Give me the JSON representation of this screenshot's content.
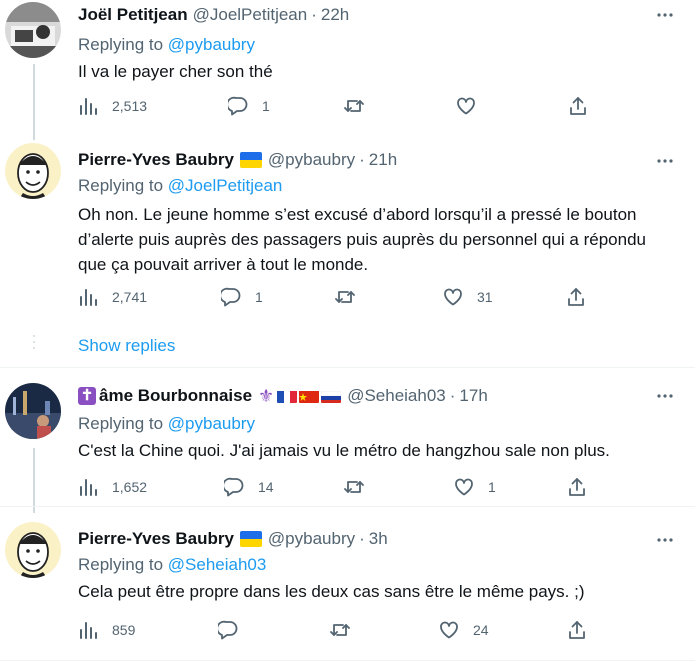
{
  "tweets": [
    {
      "name": "Joël Petitjean",
      "handle": "@JoelPetitjean",
      "time": "22h",
      "replying_prefix": "Replying to ",
      "replying_to": "@pybaubry",
      "text": "Il va le payer cher son thé",
      "stats": {
        "views": "2,513",
        "replies": "1",
        "retweets": "",
        "likes": ""
      }
    },
    {
      "name": "Pierre-Yves Baubry",
      "handle": "@pybaubry",
      "time": "21h",
      "replying_prefix": "Replying to ",
      "replying_to": "@JoelPetitjean",
      "text": "Oh non. Le jeune homme s’est excusé d’abord lorsqu’il a pressé le bouton d’alerte puis auprès des passagers puis auprès du personnel qui a répondu que ça pouvait arriver à tout le monde.",
      "stats": {
        "views": "2,741",
        "replies": "1",
        "retweets": "",
        "likes": "31"
      }
    },
    {
      "name": "âme Bourbonnaise",
      "handle": "@Seheiah03",
      "time": "17h",
      "replying_prefix": "Replying to ",
      "replying_to": "@pybaubry",
      "text": "C'est la Chine quoi. J'ai jamais vu le métro de hangzhou sale non plus.",
      "stats": {
        "views": "1,652",
        "replies": "14",
        "retweets": "",
        "likes": "1"
      }
    },
    {
      "name": "Pierre-Yves Baubry",
      "handle": "@pybaubry",
      "time": "3h",
      "replying_prefix": "Replying to ",
      "replying_to": "@Seheiah03",
      "text": "Cela peut être propre dans les deux cas sans être le même pays. ;)",
      "stats": {
        "views": "859",
        "replies": "",
        "retweets": "",
        "likes": "24"
      }
    }
  ],
  "show_replies": "Show replies",
  "dot": "·",
  "icons": [
    "more-icon",
    "views-icon",
    "reply-icon",
    "retweet-icon",
    "like-icon",
    "share-icon",
    "ukraine-flag-icon",
    "cross-icon",
    "fleur-de-lis-icon",
    "france-flag-icon",
    "china-flag-icon",
    "russia-flag-icon"
  ],
  "colors": {
    "link": "#1d9bf0",
    "secondary": "#536471",
    "border": "#eff3f4",
    "thread": "#cfd9de"
  }
}
